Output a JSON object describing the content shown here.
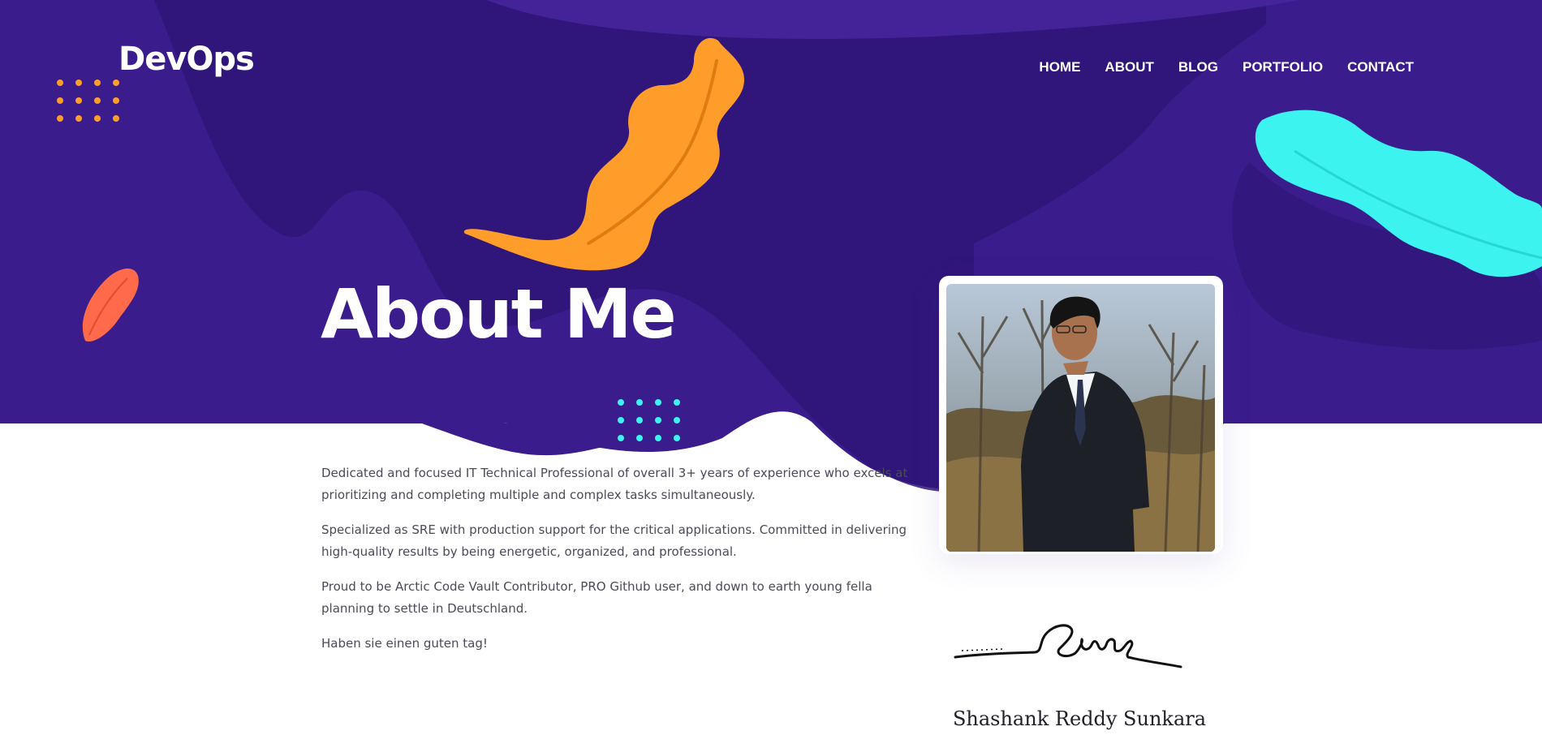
{
  "brand": {
    "logo": "DevOps"
  },
  "nav": {
    "items": [
      {
        "label": "HOME"
      },
      {
        "label": "ABOUT"
      },
      {
        "label": "BLOG"
      },
      {
        "label": "PORTFOLIO"
      },
      {
        "label": "CONTACT"
      }
    ]
  },
  "hero": {
    "title": "About Me"
  },
  "about": {
    "paragraphs": [
      "Dedicated and focused IT Technical Professional of overall 3+ years of experience who excels at prioritizing and completing multiple and complex tasks simultaneously.",
      "Specialized as SRE with production support for the critical applications. Committed in delivering high-quality results by being energetic, organized, and professional.",
      "Proud to be Arctic Code Vault Contributor, PRO Github user, and down to earth young fella planning to settle in Deutschland.",
      "Haben sie einen guten tag!"
    ]
  },
  "profile": {
    "name": "Shashank Reddy Sunkara"
  },
  "colors": {
    "hero_purple": "#3a1c8c",
    "hero_purple_dark": "#2f1578",
    "orange": "#ff9d2a",
    "coral": "#ff6b4a",
    "cyan": "#3cf3f0"
  }
}
